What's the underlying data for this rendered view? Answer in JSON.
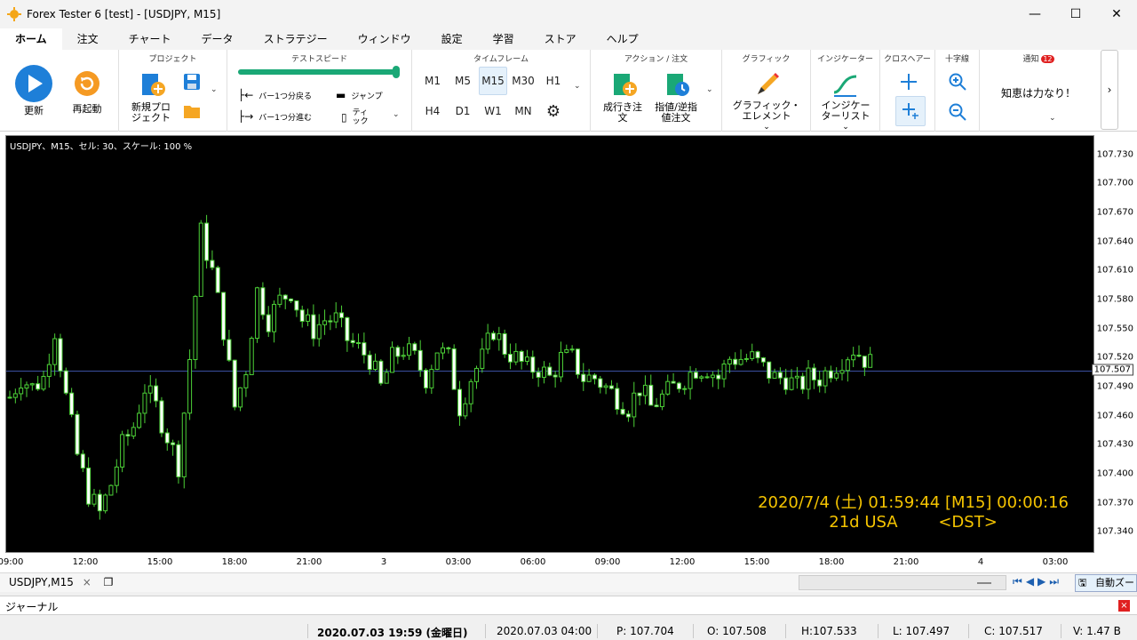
{
  "window": {
    "title": "Forex Tester 6  [test] - [USDJPY, M15]"
  },
  "tabs": [
    "ホーム",
    "注文",
    "チャート",
    "データ",
    "ストラテジー",
    "ウィンドウ",
    "設定",
    "学習",
    "ストア",
    "ヘルプ"
  ],
  "ribbon": {
    "update": "更新",
    "restart": "再起動",
    "project_group": "プロジェクト",
    "new_project_1": "新規プロ",
    "new_project_2": "ジェクト",
    "speed_group": "テストスピード",
    "speed_level": 1.0,
    "back_1min": "バー1つ分戻る",
    "forward_1min": "バー1つ分進む",
    "jump": "ジャンプ",
    "tick_1": "ティ",
    "tick_2": "ック",
    "timeframe_group": "タイムフレーム",
    "timeframes_row1": [
      "M1",
      "M5",
      "M15",
      "M30",
      "H1"
    ],
    "timeframes_row2": [
      "H4",
      "D1",
      "W1",
      "MN"
    ],
    "selected_timeframe": "M15",
    "action_group": "アクション / 注文",
    "market_order_1": "成行き注",
    "market_order_2": "文",
    "pending_order_1": "指値/逆指",
    "pending_order_2": "値注文",
    "graphic_group": "グラフィック",
    "graphic_elem_1": "グラフィック・",
    "graphic_elem_2": "エレメント",
    "indicator_group": "インジケーター",
    "indicator_list_1": "インジケー",
    "indicator_list_2": "ターリスト",
    "crosshair_group": "クロスヘアー",
    "cross_group": "十字線",
    "notify_group": "通知",
    "notify_badge": "12",
    "notify_text": "知恵は力なり！"
  },
  "chart": {
    "info": "USDJPY、M15、セル: 30、スケール: 100 %",
    "clock_line1": "2020/7/4 (土) 01:59:44 [M15] 00:00:16",
    "clock_line2": "21d USA        <DST>",
    "yticks": [
      "107.730",
      "107.700",
      "107.670",
      "107.640",
      "107.610",
      "107.580",
      "107.550",
      "107.520",
      "107.490",
      "107.460",
      "107.430",
      "107.400",
      "107.370",
      "107.340"
    ],
    "current_price": "107.507",
    "xticks": [
      "09:00",
      "12:00",
      "15:00",
      "18:00",
      "21:00",
      "3",
      "03:00",
      "06:00",
      "09:00",
      "12:00",
      "15:00",
      "18:00",
      "21:00",
      "4",
      "03:00"
    ]
  },
  "chart_data": {
    "type": "candlestick",
    "symbol": "USDJPY",
    "timeframe": "M15",
    "ylim": [
      107.32,
      107.75
    ],
    "current_price": 107.507,
    "close_path": [
      107.48,
      107.5,
      107.49,
      107.5,
      107.55,
      107.48,
      107.42,
      107.38,
      107.36,
      107.39,
      107.43,
      107.45,
      107.49,
      107.47,
      107.44,
      107.41,
      107.52,
      107.65,
      107.61,
      107.55,
      107.47,
      107.51,
      107.59,
      107.56,
      107.58,
      107.59,
      107.56,
      107.55,
      107.56,
      107.56,
      107.54,
      107.53,
      107.52,
      107.49,
      107.52,
      107.53,
      107.52,
      107.5,
      107.53,
      107.52,
      107.47,
      107.5,
      107.52,
      107.55,
      107.53,
      107.52,
      107.51,
      107.51,
      107.5,
      107.52,
      107.52,
      107.5,
      107.5,
      107.49,
      107.48,
      107.47,
      107.49,
      107.47,
      107.48,
      107.49,
      107.5,
      107.51,
      107.51,
      107.5,
      107.52,
      107.52,
      107.52,
      107.51,
      107.5,
      107.5,
      107.49,
      107.5,
      107.5,
      107.51,
      107.52,
      107.53,
      107.52,
      107.51
    ]
  },
  "tabs_bottom": {
    "doc": "USDJPY,M15",
    "zoom": "自動ズー"
  },
  "journal": {
    "label": "ジャーナル"
  },
  "status": {
    "datetime": "2020.07.03 19:59 (金曜日)",
    "bar_time": "2020.07.03 04:00",
    "p": "P: 107.704",
    "o": "O: 107.508",
    "h": "H:107.533",
    "l": "L: 107.497",
    "c": "C: 107.517",
    "v": "V: 1.47 B"
  }
}
